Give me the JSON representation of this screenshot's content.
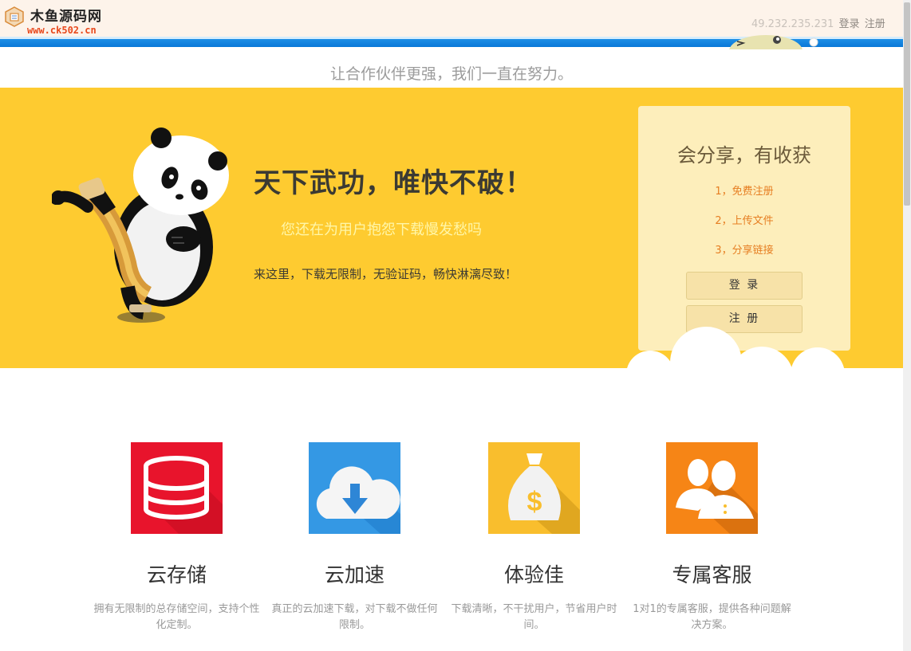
{
  "header": {
    "brand": "木鱼源码网",
    "brand_url": "www.ck502.cn",
    "ip": "49.232.235.231",
    "login_link": "登录",
    "register_link": "注册"
  },
  "slogan": "让合作伙伴更强，我们一直在努力。",
  "hero": {
    "title": "天下武功，唯快不破！",
    "subtitle": "您还在为用户抱怨下载慢发愁吗",
    "description": "来这里，下载无限制，无验证码，畅快淋漓尽致！"
  },
  "card": {
    "title": "会分享，有收获",
    "steps": [
      "1，免费注册",
      "2，上传文件",
      "3，分享链接"
    ],
    "login_button": "登 录",
    "register_button": "注 册"
  },
  "features": [
    {
      "title": "云存储",
      "desc": "拥有无限制的总存储空间，支持个性化定制。",
      "icon": "database-icon",
      "color": "#e8142c"
    },
    {
      "title": "云加速",
      "desc": "真正的云加速下载，对下载不做任何限制。",
      "icon": "cloud-download-icon",
      "color": "#3498e4"
    },
    {
      "title": "体验佳",
      "desc": "下载清晰，不干扰用户，节省用户时间。",
      "icon": "money-bag-icon",
      "color": "#f9be2d"
    },
    {
      "title": "专属客服",
      "desc": "1对1的专属客服，提供各种问题解决方案。",
      "icon": "users-icon",
      "color": "#f68516"
    }
  ],
  "colors": {
    "hero_bg": "#fecb30",
    "accent_blue": "#0a78d8",
    "step_orange": "#e67e22"
  }
}
